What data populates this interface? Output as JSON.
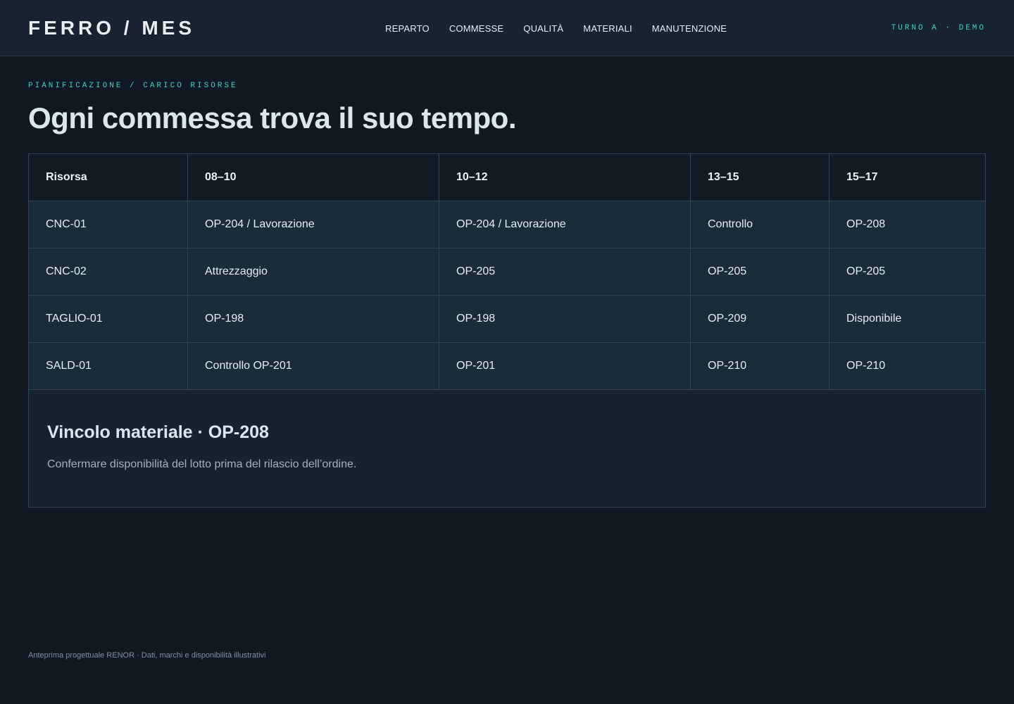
{
  "header": {
    "brand": "FERRO / MES",
    "nav": [
      "REPARTO",
      "COMMESSE",
      "QUALITÀ",
      "MATERIALI",
      "MANUTENZIONE"
    ],
    "shift": "TURNO A · DEMO"
  },
  "main": {
    "breadcrumb": "PIANIFICAZIONE / CARICO RISORSE",
    "title": "Ogni commessa trova il suo tempo.",
    "table": {
      "headers": [
        "Risorsa",
        "08–10",
        "10–12",
        "13–15",
        "15–17"
      ],
      "rows": [
        [
          "CNC-01",
          "OP-204 / Lavorazione",
          "OP-204 / Lavorazione",
          "Controllo",
          "OP-208"
        ],
        [
          "CNC-02",
          "Attrezzaggio",
          "OP-205",
          "OP-205",
          "OP-205"
        ],
        [
          "TAGLIO-01",
          "OP-198",
          "OP-198",
          "OP-209",
          "Disponibile"
        ],
        [
          "SALD-01",
          "Controllo OP-201",
          "OP-201",
          "OP-210",
          "OP-210"
        ]
      ]
    },
    "note": {
      "title": "Vincolo materiale · OP-208",
      "text": "Confermare disponibilità del lotto prima del rilascio dell’ordine."
    }
  },
  "footer": {
    "text": "Anteprima progettuale RENOR · Dati, marchi e disponibilità illustrativi"
  },
  "colors": {
    "background": "#101922",
    "header_bg": "#17242f",
    "accent": "#3fd1c0",
    "cell_bg": "#1b2c39"
  }
}
